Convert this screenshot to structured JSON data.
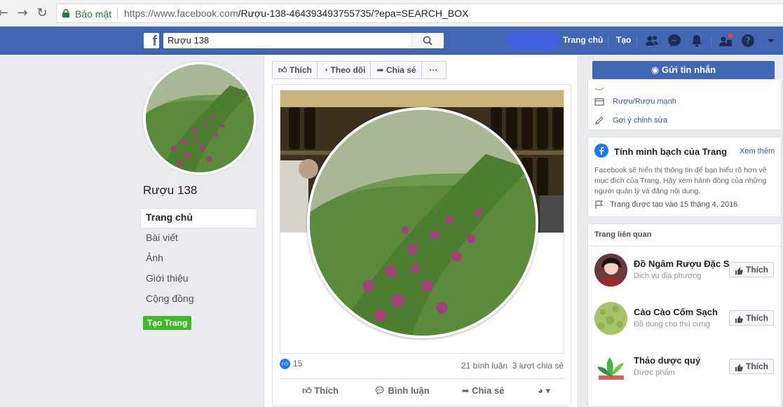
{
  "browser": {
    "secure_label": "Bảo mật",
    "url_host": "https://www.facebook.com",
    "url_path": "/Rượu-138-464393493755735/?epa=SEARCH_BOX"
  },
  "topbar": {
    "search_value": "Rượu 138",
    "home_label": "Trang chủ",
    "create_label": "Tạo"
  },
  "page": {
    "name": "Rượu 138",
    "nav": [
      "Trang chủ",
      "Bài viết",
      "Ảnh",
      "Giới thiệu",
      "Cộng đồng"
    ],
    "create_page": "Tạo Trang"
  },
  "actions": {
    "like": "Thích",
    "follow": "Theo dõi",
    "share": "Chia sẻ",
    "more": "···",
    "message": "Gửi tin nhắn"
  },
  "post": {
    "like_count": "15",
    "comments": "21 bình luận",
    "shares": "3 lượt chia sẻ",
    "like": "Thích",
    "comment": "Bình luận",
    "share": "Chia sẻ"
  },
  "about": {
    "category": "Rượu/Rượu mạnh",
    "suggest_edit": "Gợi ý chỉnh sửa"
  },
  "transparency": {
    "title": "Tính minh bạch của Trang",
    "see_more": "Xem thêm",
    "body": "Facebook sẽ hiển thị thông tin để bạn hiểu rõ hơn về mục đích của Trang. Hãy xem hành động của những người quản lý và đăng nội dung.",
    "created": "Trang được tạo vào 15 tháng 4, 2016"
  },
  "related": {
    "title": "Trang liên quan",
    "like_label": "Thích",
    "items": [
      {
        "name": "Đồ Ngâm Rượu Đặc S...",
        "category": "Dịch vụ địa phương"
      },
      {
        "name": "Cào Cào Cốm Sạch",
        "category": "Đồ dùng cho thú cưng"
      },
      {
        "name": "Thảo dược quý",
        "category": "Dược phẩm"
      }
    ]
  },
  "colors": {
    "fb_blue": "#4267b2",
    "green": "#42b72a",
    "link": "#365899"
  }
}
